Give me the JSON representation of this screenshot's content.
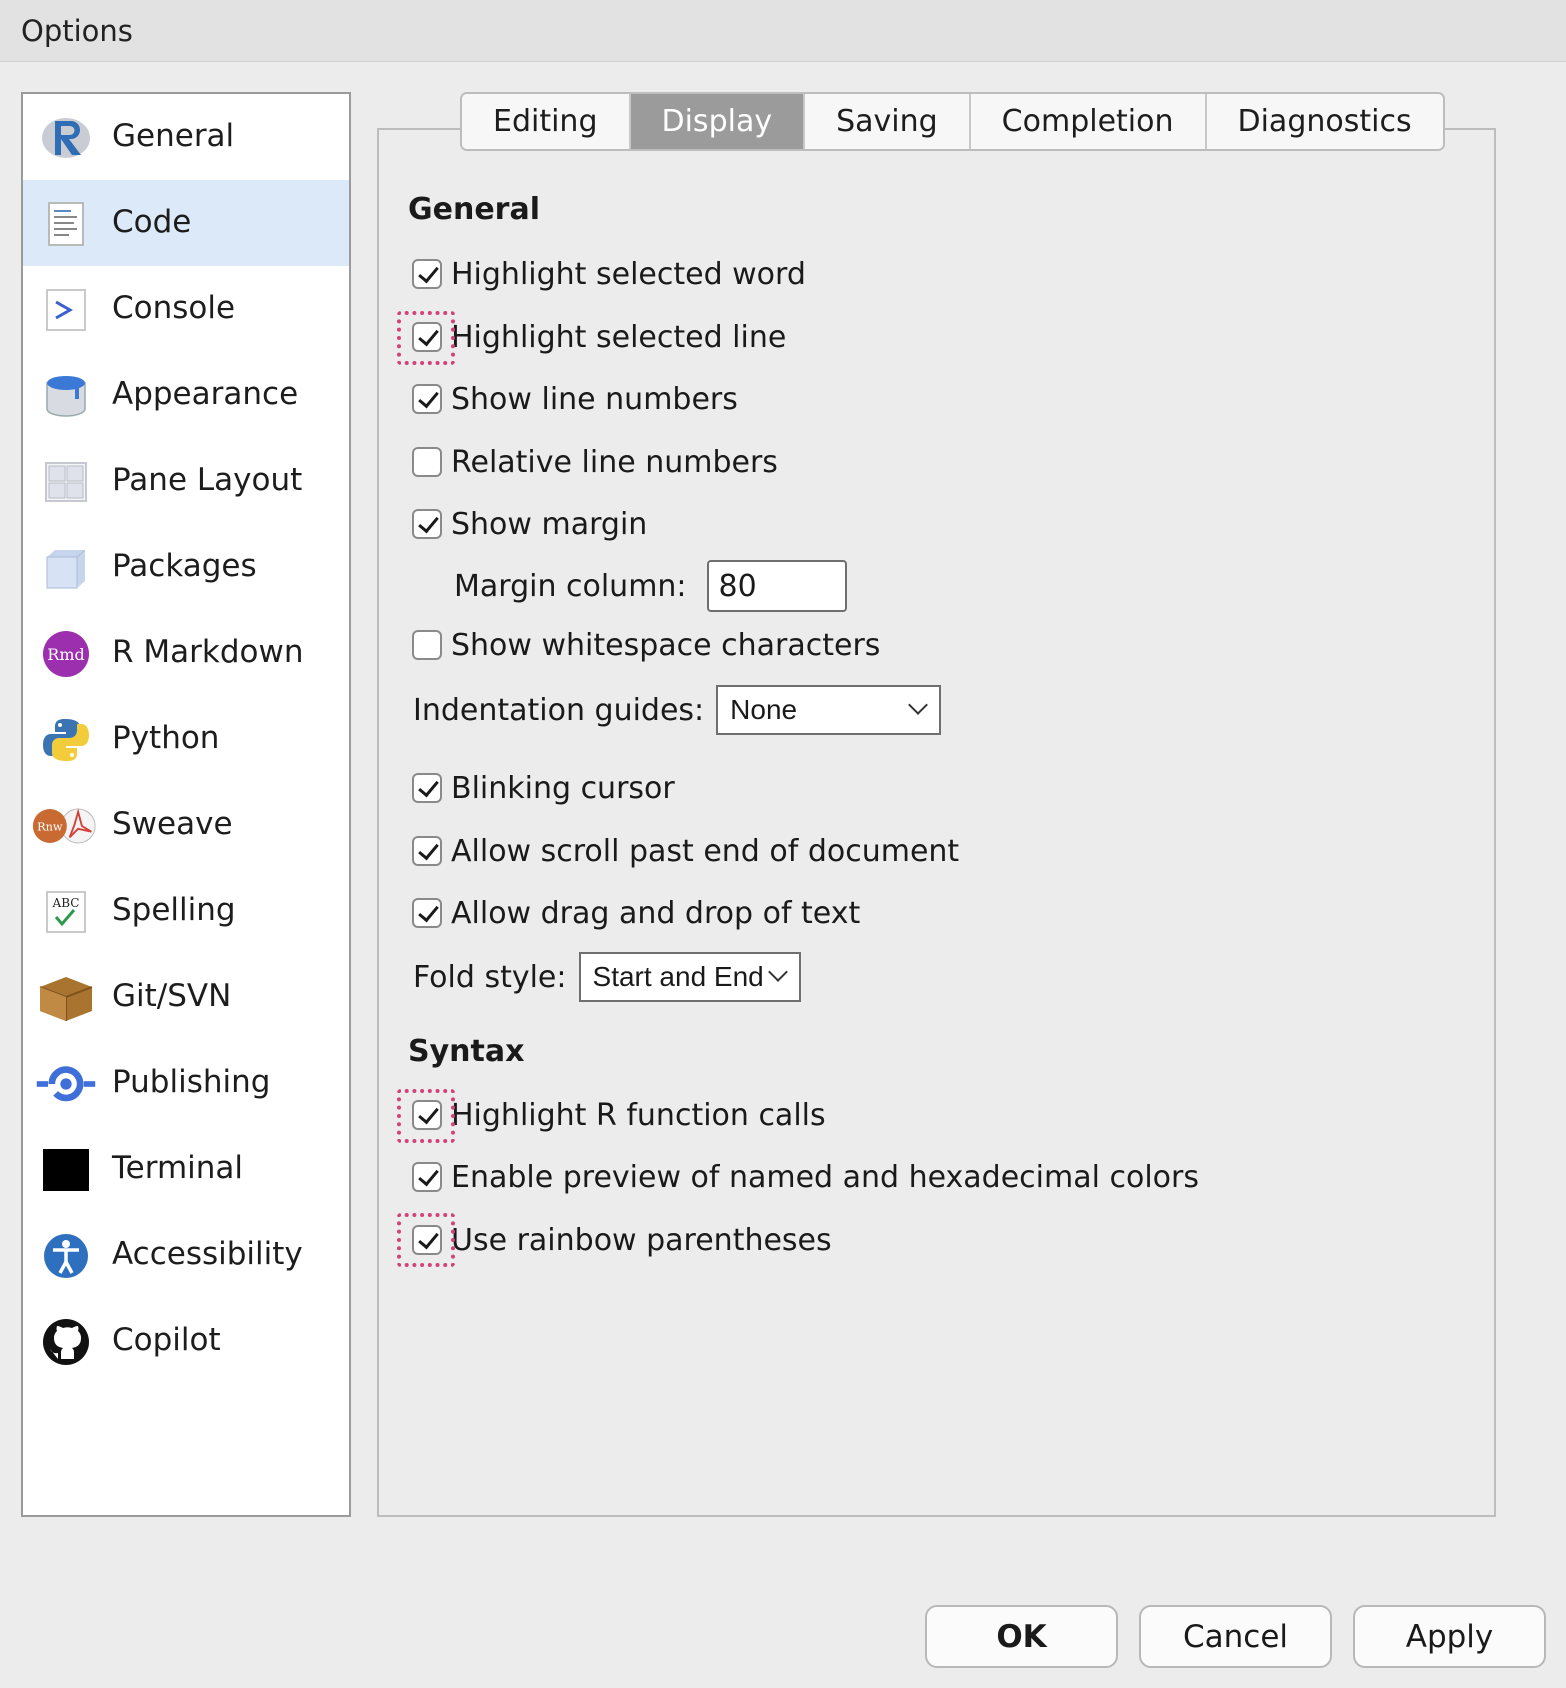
{
  "window": {
    "title": "Options"
  },
  "sidebar": {
    "items": [
      {
        "label": "General",
        "icon": "r-logo-icon"
      },
      {
        "label": "Code",
        "icon": "code-document-icon",
        "selected": true
      },
      {
        "label": "Console",
        "icon": "console-prompt-icon"
      },
      {
        "label": "Appearance",
        "icon": "paint-bucket-icon"
      },
      {
        "label": "Pane Layout",
        "icon": "pane-grid-icon"
      },
      {
        "label": "Packages",
        "icon": "package-cube-icon"
      },
      {
        "label": "R Markdown",
        "icon": "rmd-icon"
      },
      {
        "label": "Python",
        "icon": "python-icon"
      },
      {
        "label": "Sweave",
        "icon": "sweave-icon"
      },
      {
        "label": "Spelling",
        "icon": "spelling-abc-icon"
      },
      {
        "label": "Git/SVN",
        "icon": "git-box-icon"
      },
      {
        "label": "Publishing",
        "icon": "publishing-icon"
      },
      {
        "label": "Terminal",
        "icon": "terminal-icon"
      },
      {
        "label": "Accessibility",
        "icon": "accessibility-icon"
      },
      {
        "label": "Copilot",
        "icon": "github-icon"
      }
    ]
  },
  "tabs": [
    {
      "label": "Editing"
    },
    {
      "label": "Display",
      "active": true
    },
    {
      "label": "Saving"
    },
    {
      "label": "Completion"
    },
    {
      "label": "Diagnostics"
    }
  ],
  "display": {
    "general_heading": "General",
    "options": {
      "highlight_word": {
        "label": "Highlight selected word",
        "checked": true
      },
      "highlight_line": {
        "label": "Highlight selected line",
        "checked": true
      },
      "line_numbers": {
        "label": "Show line numbers",
        "checked": true
      },
      "relative_numbers": {
        "label": "Relative line numbers",
        "checked": false
      },
      "show_margin": {
        "label": "Show margin",
        "checked": true
      },
      "whitespace": {
        "label": "Show whitespace characters",
        "checked": false
      },
      "blinking_cursor": {
        "label": "Blinking cursor",
        "checked": true
      },
      "scroll_past": {
        "label": "Allow scroll past end of document",
        "checked": true
      },
      "drag_drop": {
        "label": "Allow drag and drop of text",
        "checked": true
      },
      "r_function_calls": {
        "label": "Highlight R function calls",
        "checked": true
      },
      "color_preview": {
        "label": "Enable preview of named and hexadecimal colors",
        "checked": true
      },
      "rainbow_parens": {
        "label": "Use rainbow parentheses",
        "checked": true
      }
    },
    "margin_column": {
      "label": "Margin column:",
      "value": "80"
    },
    "indentation_guides": {
      "label": "Indentation guides:",
      "value": "None"
    },
    "fold_style": {
      "label": "Fold style:",
      "value": "Start and End"
    },
    "syntax_heading": "Syntax"
  },
  "buttons": {
    "ok": "OK",
    "cancel": "Cancel",
    "apply": "Apply"
  },
  "colors": {
    "selected_bg": "#dbe9f8",
    "active_tab": "#9b9b9b",
    "annotation": "#d0427a"
  }
}
